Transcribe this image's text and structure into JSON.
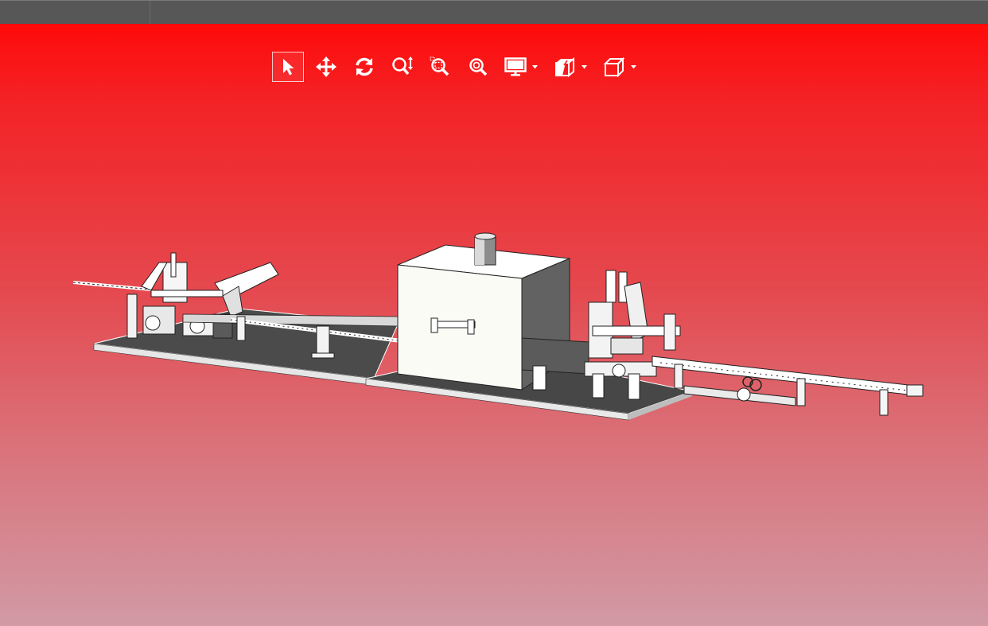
{
  "app": {
    "title": ""
  },
  "colors": {
    "titlebar": "#575757",
    "viewport_top": "#ff0a0a",
    "viewport_bottom": "#d19aa5",
    "icon": "#ffffff",
    "model_face": "#f8f8f4",
    "model_shadow": "#5e5e5e",
    "model_base": "#4b4b4b"
  },
  "toolbar": {
    "tools": [
      {
        "id": "select",
        "icon": "cursor-arrow-icon",
        "active": true
      },
      {
        "id": "pan",
        "icon": "move-arrows-icon",
        "active": false
      },
      {
        "id": "rotate",
        "icon": "rotate-icon",
        "active": false
      },
      {
        "id": "zoom",
        "icon": "zoom-vertical-icon",
        "active": false
      },
      {
        "id": "zoom-window",
        "icon": "zoom-window-icon",
        "active": false
      },
      {
        "id": "zoom-fit",
        "icon": "zoom-fit-icon",
        "active": false
      },
      {
        "id": "display-mode",
        "icon": "monitor-icon",
        "dropdown": true
      },
      {
        "id": "section-view",
        "icon": "section-box-icon",
        "dropdown": true
      },
      {
        "id": "view-orientation",
        "icon": "cube-icon",
        "dropdown": true
      }
    ]
  },
  "viewport": {
    "content": "3d-model-production-line"
  }
}
